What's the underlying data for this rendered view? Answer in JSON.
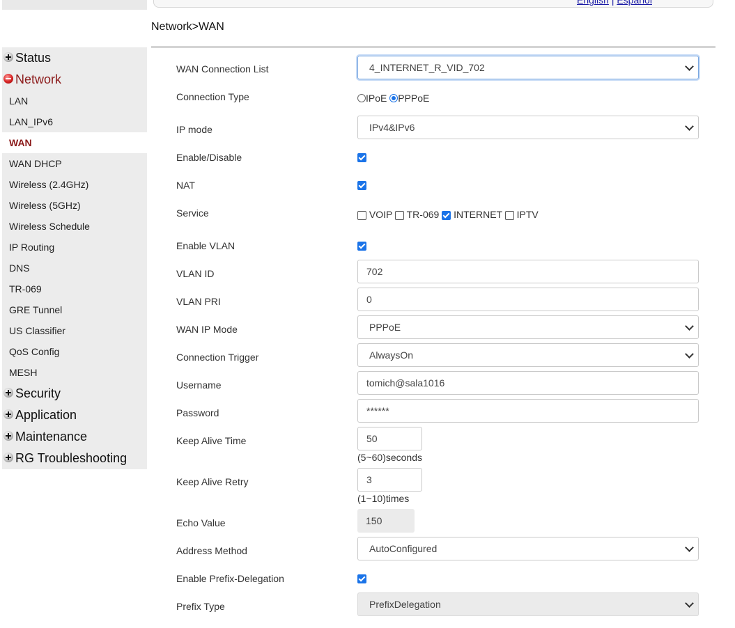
{
  "header": {
    "lang_english": "English",
    "lang_sep": "|",
    "lang_espanol": "Español"
  },
  "breadcrumb": "Network>WAN",
  "sidebar": {
    "status": "Status",
    "network": "Network",
    "network_items": [
      "LAN",
      "LAN_IPv6",
      "WAN",
      "WAN DHCP",
      "Wireless (2.4GHz)",
      "Wireless (5GHz)",
      "Wireless Schedule",
      "IP Routing",
      "DNS",
      "TR-069",
      "GRE Tunnel",
      "US Classifier",
      "QoS Config",
      "MESH"
    ],
    "selected_item": "WAN",
    "security": "Security",
    "application": "Application",
    "maintenance": "Maintenance",
    "rg_troubleshooting": "RG Troubleshooting"
  },
  "form": {
    "wan_connection_list": {
      "label": "WAN Connection List",
      "value": "4_INTERNET_R_VID_702"
    },
    "connection_type": {
      "label": "Connection Type",
      "opt_ipoe": "IPoE",
      "opt_pppoe": "PPPoE",
      "selected": "PPPoE"
    },
    "ip_mode": {
      "label": "IP mode",
      "value": "IPv4&IPv6"
    },
    "enable_disable": {
      "label": "Enable/Disable",
      "checked": true
    },
    "nat": {
      "label": "NAT",
      "checked": true
    },
    "service": {
      "label": "Service",
      "voip": "VOIP",
      "tr069": "TR-069",
      "internet": "INTERNET",
      "iptv": "IPTV"
    },
    "enable_vlan": {
      "label": "Enable VLAN",
      "checked": true
    },
    "vlan_id": {
      "label": "VLAN ID",
      "value": "702"
    },
    "vlan_pri": {
      "label": "VLAN PRI",
      "value": "0"
    },
    "wan_ip_mode": {
      "label": "WAN IP Mode",
      "value": "PPPoE"
    },
    "connection_trigger": {
      "label": "Connection Trigger",
      "value": "AlwaysOn"
    },
    "username": {
      "label": "Username",
      "value": "tomich@sala1016"
    },
    "password": {
      "label": "Password",
      "value": "******"
    },
    "keep_alive_time": {
      "label": "Keep Alive Time",
      "value": "50",
      "hint": "(5~60)seconds"
    },
    "keep_alive_retry": {
      "label": "Keep Alive Retry",
      "value": "3",
      "hint": "(1~10)times"
    },
    "echo_value": {
      "label": "Echo Value",
      "value": "150"
    },
    "address_method": {
      "label": "Address Method",
      "value": "AutoConfigured"
    },
    "enable_prefix_delegation": {
      "label": "Enable Prefix-Delegation",
      "checked": true
    },
    "prefix_type": {
      "label": "Prefix Type",
      "value": "PrefixDelegation"
    }
  },
  "colors": {
    "accent": "#8b1a1a",
    "checkbox": "#1a73e8",
    "link": "#1a1aa6"
  }
}
